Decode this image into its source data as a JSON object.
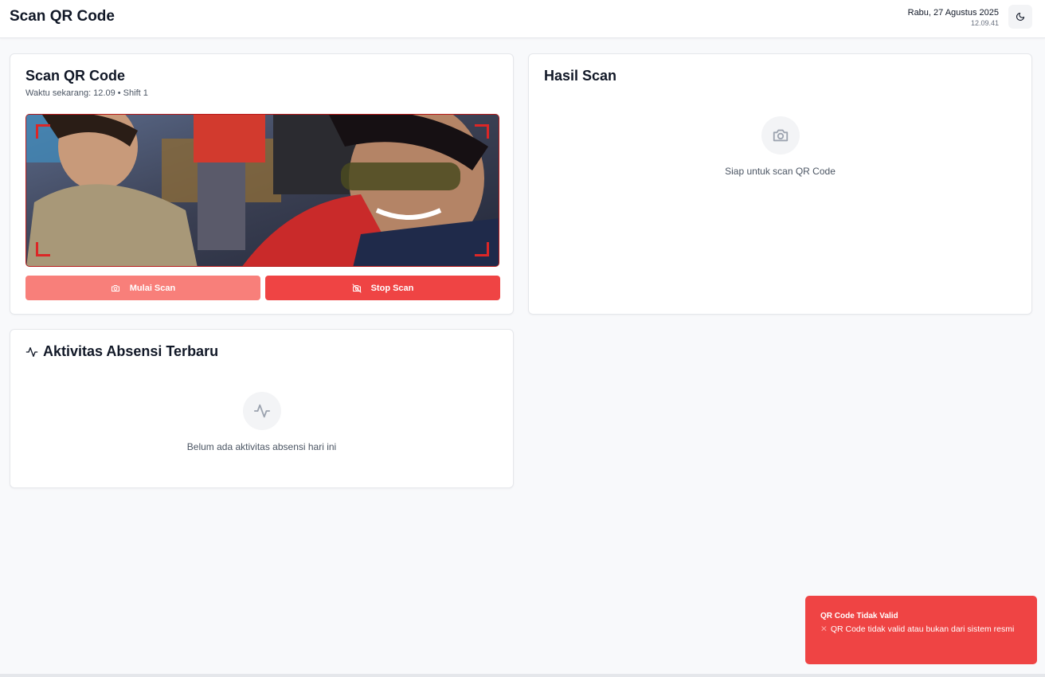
{
  "header": {
    "title": "Scan QR Code",
    "date": "Rabu, 27 Agustus 2025",
    "time": "12.09.41",
    "theme_icon": "moon-icon"
  },
  "scan_card": {
    "title": "Scan QR Code",
    "subtitle": "Waktu sekarang: 12.09 • Shift 1",
    "start_label": "Mulai Scan",
    "stop_label": "Stop Scan",
    "start_icon": "camera-icon",
    "stop_icon": "camera-off-icon"
  },
  "result_card": {
    "title": "Hasil Scan",
    "empty_text": "Siap untuk scan QR Code",
    "empty_icon": "camera-icon"
  },
  "activity_card": {
    "title": "Aktivitas Absensi Terbaru",
    "title_icon": "activity-icon",
    "empty_text": "Belum ada aktivitas absensi hari ini"
  },
  "toast": {
    "title": "QR Code Tidak Valid",
    "icon": "x-icon",
    "message": "QR Code tidak valid atau bukan dari sistem resmi"
  },
  "colors": {
    "danger": "#ef4444",
    "danger_light": "#f87f7a",
    "background": "#f8f9fb"
  }
}
